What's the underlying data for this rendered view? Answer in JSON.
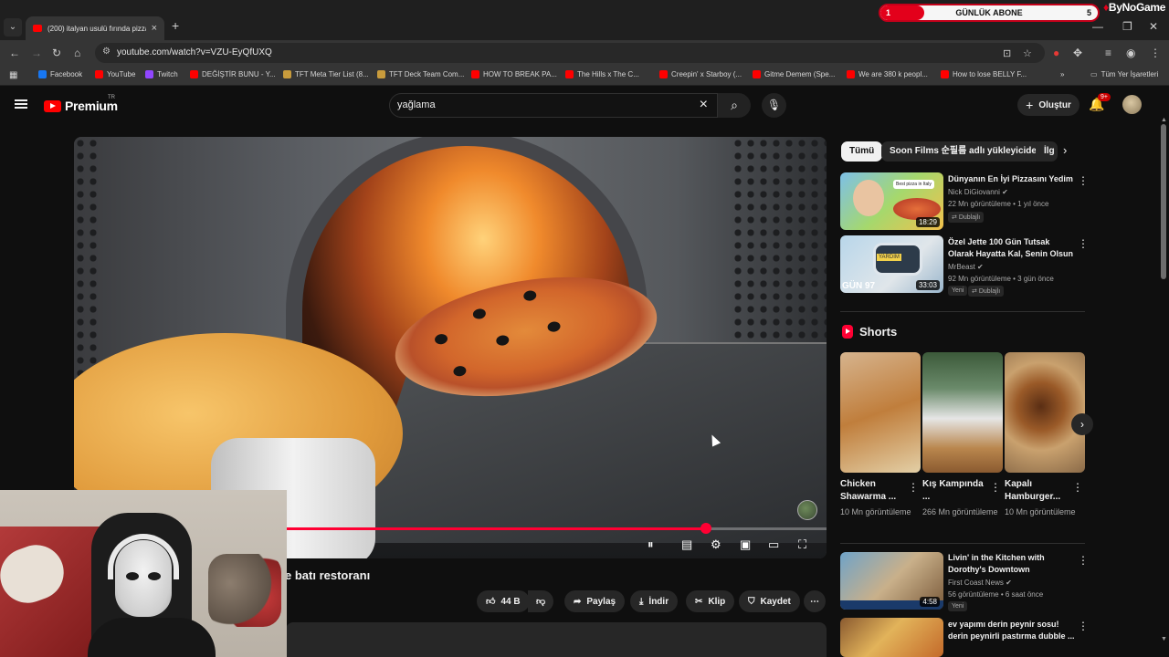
{
  "browser": {
    "tab_title": "(200) italyan usulü fırında pizza",
    "url": "youtube.com/watch?v=VZU-EyQfUXQ",
    "bookmarks": [
      {
        "label": "Facebook",
        "color": "#1877f2"
      },
      {
        "label": "YouTube",
        "color": "#ff0000"
      },
      {
        "label": "Twitch",
        "color": "#9146ff"
      },
      {
        "label": "DEĞİŞTİR BUNU - Y...",
        "color": "#ff0000"
      },
      {
        "label": "TFT Meta Tier List (8...",
        "color": "#c89b3c"
      },
      {
        "label": "TFT Deck Team Com...",
        "color": "#c89b3c"
      },
      {
        "label": "HOW TO BREAK PA...",
        "color": "#ff0000"
      },
      {
        "label": "The Hills x The C...",
        "color": "#ff0000"
      },
      {
        "label": "Creepin' x Starboy (...",
        "color": "#ff0000"
      },
      {
        "label": "Gitme Demem (Spe...",
        "color": "#ff0000"
      },
      {
        "label": "We are 380 k peopl...",
        "color": "#ff0000"
      },
      {
        "label": "How to lose BELLY F...",
        "color": "#ff0000"
      }
    ],
    "all_bookmarks_label": "Tüm Yer İşaretleri",
    "more_bookmarks": "»"
  },
  "overlay": {
    "abone_label": "GÜNLÜK ABONE",
    "abone_current": "1",
    "abone_goal": "5",
    "abone_fraction": 0.2,
    "brand": "ByNoGame"
  },
  "yt": {
    "logo_word": "Premium",
    "logo_country": "TR",
    "search_query": "yağlama",
    "create_label": "Oluştur",
    "notif_badge": "9+"
  },
  "player": {
    "progress_fraction": 0.84,
    "title_fragment": "e batı restoranı"
  },
  "actions": {
    "likes": "44 B",
    "share": "Paylaş",
    "download": "İndir",
    "clip": "Klip",
    "save": "Kaydet"
  },
  "chips": [
    "Tümü",
    "Soon Films 순필름 adlı yükleyiciden",
    "İlg"
  ],
  "recommended": [
    {
      "title": "Dünyanın En İyi Pizzasını Yedim",
      "channel": "Nick DiGiovanni",
      "meta": "22 Mn görüntüleme • 1 yıl önce",
      "badges": [
        "Dublajlı"
      ],
      "duration": "18:29"
    },
    {
      "title": "Özel Jette 100 Gün Tutsak Olarak Hayatta Kal, Senin Olsun",
      "channel": "MrBeast",
      "meta": "92 Mn görüntüleme • 3 gün önce",
      "badges": [
        "Yeni",
        "Dublajlı"
      ],
      "duration": "33:03"
    }
  ],
  "shorts_title": "Shorts",
  "shorts": [
    {
      "title": "Chicken Shawarma ...",
      "views": "10 Mn görüntüleme"
    },
    {
      "title": "Kış Kampında ...",
      "views": "266 Mn görüntüleme"
    },
    {
      "title": "Kapalı Hamburger...",
      "views": "10 Mn görüntüleme"
    }
  ],
  "recommended_more": [
    {
      "title": "Livin' in the Kitchen with Dorothy's Downtown",
      "channel": "First Coast News",
      "meta": "56 görüntüleme • 6 saat önce",
      "badges": [
        "Yeni"
      ],
      "duration": "4:58"
    },
    {
      "title": "ev yapımı derin peynir sosu! derin peynirli pastırma dubble ..."
    }
  ],
  "thumb_text": {
    "pizza_badge": "Best pizza in Italy",
    "day_label": "GÜN 97",
    "help_sign": "YARDIM"
  }
}
